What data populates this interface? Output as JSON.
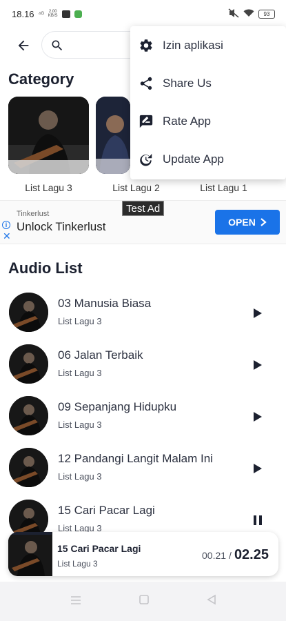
{
  "status_bar": {
    "time": "18.16",
    "signal": "⁴ᴳ",
    "data_rate_value": "2,00",
    "data_rate_unit": "KB/S",
    "battery": "93"
  },
  "search": {
    "placeholder": ""
  },
  "category": {
    "title": "Category",
    "items": [
      {
        "label": "List Lagu 3"
      },
      {
        "label": "List Lagu 2"
      },
      {
        "label": "List Lagu 1"
      }
    ]
  },
  "ad": {
    "tag": "Test Ad",
    "brand": "Tinkerlust",
    "headline": "Unlock Tinkerlust",
    "cta": "OPEN",
    "cta_color": "#1a73e8"
  },
  "audio_list": {
    "title": "Audio List",
    "items": [
      {
        "title": "03 Manusia Biasa",
        "subtitle": "List Lagu 3",
        "state": "play-icon"
      },
      {
        "title": "06 Jalan Terbaik",
        "subtitle": "List Lagu 3",
        "state": "play-icon"
      },
      {
        "title": "09 Sepanjang Hidupku",
        "subtitle": "List Lagu 3",
        "state": "play-icon"
      },
      {
        "title": "12 Pandangi Langit Malam Ini",
        "subtitle": "List Lagu 3",
        "state": "play-icon"
      },
      {
        "title": "15 Cari Pacar Lagi",
        "subtitle": "List Lagu 3",
        "state": "pause-icon"
      }
    ]
  },
  "player": {
    "title": "15 Cari Pacar Lagi",
    "subtitle": "List Lagu 3",
    "elapsed": "00.21",
    "separator": "/",
    "duration": "02.25",
    "progress_fraction": 0.16
  },
  "menu": {
    "items": [
      {
        "label": "Izin aplikasi",
        "icon": "gear-icon"
      },
      {
        "label": "Share Us",
        "icon": "share-icon"
      },
      {
        "label": "Rate App",
        "icon": "rate-icon"
      },
      {
        "label": "Update App",
        "icon": "update-icon"
      }
    ]
  },
  "colors": {
    "text_dark": "#1c2130",
    "accent": "#1c2130"
  }
}
